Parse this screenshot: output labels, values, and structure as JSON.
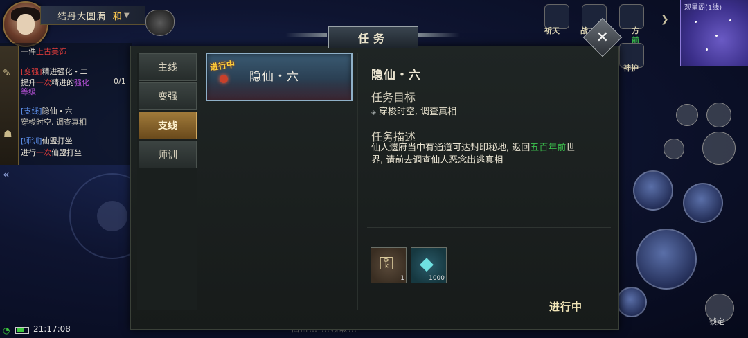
{
  "player": {
    "title": "结丹大圆满",
    "tag": "和"
  },
  "tracker": {
    "lines": [
      {
        "parts": [
          "一件",
          "上古美饰"
        ]
      },
      {
        "parts": [
          "[变强]",
          "精进强化・二",
          "0/1"
        ]
      },
      {
        "parts": [
          "提升",
          "一次",
          "精进的",
          "强化",
          "等级"
        ]
      },
      {
        "parts": [
          "[支线]",
          "隐仙・六"
        ]
      },
      {
        "parts": [
          "穿梭时空, 调查真相"
        ]
      },
      {
        "parts": [
          "[师训]",
          "仙盟打坐"
        ]
      },
      {
        "parts": [
          "进行",
          "一次",
          "仙盟打坐"
        ]
      }
    ]
  },
  "top_icons": {
    "labels": [
      "祈天",
      "战",
      "方",
      "前",
      "神护"
    ]
  },
  "minimap": {
    "title": "观星阁(1线)"
  },
  "lock_label": "锁定",
  "status_bar": {
    "time": "21:17:08"
  },
  "dialog": {
    "title": "任务",
    "close_glyph": "✕",
    "tabs": [
      {
        "label": "主线",
        "active": false
      },
      {
        "label": "变强",
        "active": false
      },
      {
        "label": "支线",
        "active": true
      },
      {
        "label": "师训",
        "active": false
      }
    ],
    "quest_card": {
      "badge": "进行中",
      "name": "隐仙・六"
    },
    "detail": {
      "title": "隐仙・六",
      "objective_label": "任务目标",
      "objective": "穿梭时空, 调查真相",
      "description_label": "任务描述",
      "description_before": "仙人遗府当中有通道可达封印秘地, 返回",
      "description_highlight": "五百年前",
      "description_after": "世界, 请前去调查仙人恶念出逃真相"
    },
    "rewards": [
      {
        "icon": "token-icon",
        "count": "1"
      },
      {
        "icon": "crystal-icon",
        "count": "1000"
      }
    ],
    "status": "进行中"
  },
  "background_text": "仙盟…  …领取…"
}
